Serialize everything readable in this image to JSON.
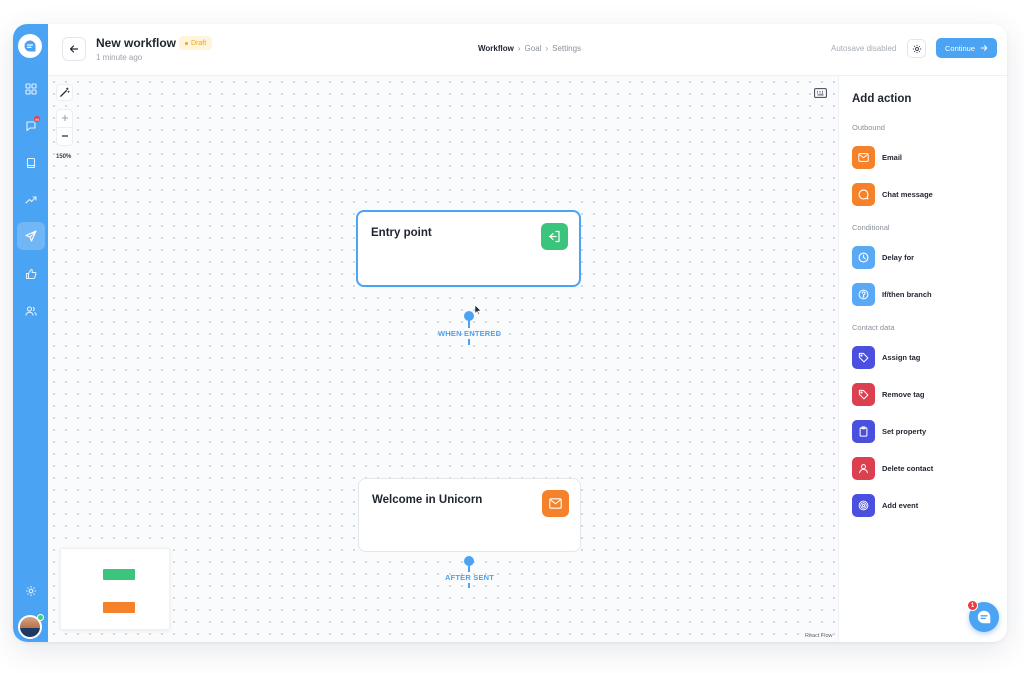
{
  "header": {
    "title": "New workflow",
    "status_badge": "Draft",
    "updated": "1 minute ago",
    "breadcrumbs": [
      {
        "label": "Workflow",
        "sep": "›"
      },
      {
        "label": "Goal",
        "sep": "›"
      },
      {
        "label": "Settings",
        "sep": ""
      }
    ],
    "autosave": "Autosave disabled",
    "continue_label": "Continue"
  },
  "sidebar": {
    "items": [
      {
        "name": "dashboard",
        "icon": "grid-icon"
      },
      {
        "name": "conversations",
        "icon": "chat-icon",
        "badge": "99"
      },
      {
        "name": "knowledge-base",
        "icon": "book-icon"
      },
      {
        "name": "analytics",
        "icon": "trending-up-icon"
      },
      {
        "name": "campaigns",
        "icon": "send-icon",
        "active": true
      },
      {
        "name": "feedback",
        "icon": "thumbs-up-icon"
      },
      {
        "name": "contacts",
        "icon": "users-icon"
      }
    ],
    "settings_icon": "gear-icon"
  },
  "canvas": {
    "zoom_level": "150%",
    "nodes": [
      {
        "title": "Entry point",
        "icon": "enter-icon",
        "color": "#3cc47c",
        "edge_label": "WHEN ENTERED"
      },
      {
        "title": "Welcome in Unicorn",
        "icon": "mail-icon",
        "color": "#f5822a",
        "edge_label": "AFTER SENT"
      }
    ],
    "attribution": "React Flow"
  },
  "panel": {
    "title": "Add action",
    "sections": [
      {
        "title": "Outbound",
        "actions": [
          {
            "label": "Email",
            "icon": "mail-icon",
            "color": "#f5822a"
          },
          {
            "label": "Chat message",
            "icon": "chat-bubble-icon",
            "color": "#f5822a"
          }
        ]
      },
      {
        "title": "Conditional",
        "actions": [
          {
            "label": "Delay for",
            "icon": "clock-icon",
            "color": "#5aa9f5"
          },
          {
            "label": "If/then branch",
            "icon": "question-icon",
            "color": "#5aa9f5"
          }
        ]
      },
      {
        "title": "Contact data",
        "actions": [
          {
            "label": "Assign tag",
            "icon": "tag-icon",
            "color": "#4b4fe0"
          },
          {
            "label": "Remove tag",
            "icon": "tag-icon",
            "color": "#dc3f4f"
          },
          {
            "label": "Set property",
            "icon": "clipboard-icon",
            "color": "#4b4fe0"
          },
          {
            "label": "Delete contact",
            "icon": "user-icon",
            "color": "#dc3f4f"
          },
          {
            "label": "Add event",
            "icon": "target-icon",
            "color": "#4b4fe0"
          }
        ]
      }
    ]
  },
  "chat_widget": {
    "badge": "1"
  },
  "colors": {
    "accent": "#4ba3f3",
    "green": "#3cc47c",
    "orange": "#f5822a",
    "indigo": "#4b4fe0",
    "red": "#dc3f4f"
  }
}
